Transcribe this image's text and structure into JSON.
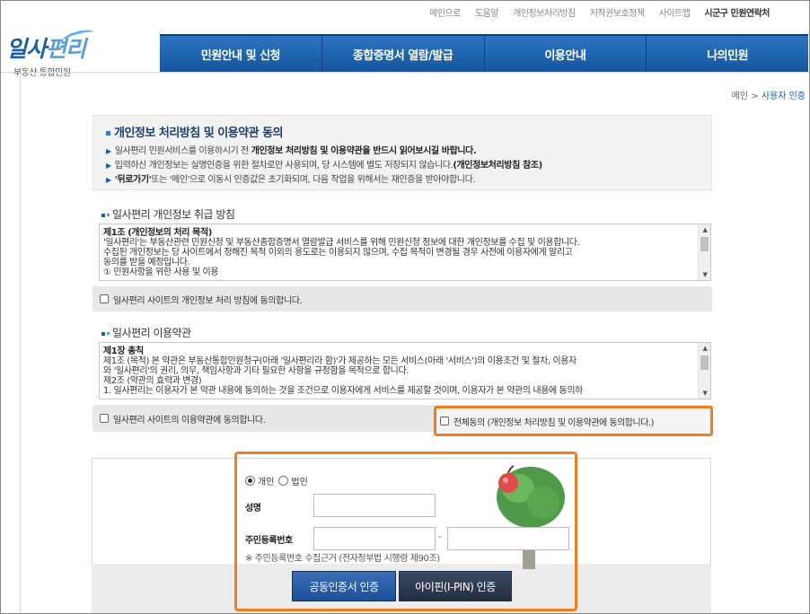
{
  "utility_links": [
    "메인으로",
    "도움말",
    "개인정보처리방침",
    "저작권보호정책",
    "사이트맵",
    "시군구 민원연락처"
  ],
  "logo": {
    "mark_main": "일사",
    "mark_accent": "편리",
    "subtitle": "부동산 통합민원"
  },
  "nav": [
    "민원안내 및 신청",
    "종합증명서 열람/발급",
    "이용안내",
    "나의민원"
  ],
  "breadcrumb": {
    "home": "메인",
    "separator": ">",
    "current": "사용자 인증"
  },
  "notice": {
    "title": "개인정보 처리방침 및 이용약관 동의",
    "items": [
      {
        "pre": "일사편리 민원서비스를 이용하시기 전 ",
        "bold": "개인정보 처리방침 및 이용약관을 반드시 읽어보시길 바랍니다.",
        "post": ""
      },
      {
        "pre": "입력하신 개인정보는 실명인증을 위한 절차로만 사용되며, 당 시스템에 별도 저장되지 않습니다.",
        "bold": "(개인정보처리방침 참조)",
        "post": ""
      },
      {
        "pre": "",
        "bold": "'뒤로가기'",
        "post": "또는 '메인'으로 이동시 인증값은 초기화되며, 다음 작업을 위해서는 재인증을 받아야합니다."
      }
    ]
  },
  "privacy": {
    "section_title": "일사편리 개인정보 취급 방침",
    "heading": "제1조 (개인정보의 처리 목적)",
    "lines": [
      "'일사편리'는 부동산관련 민원신청 및 부동산종합증명서 열람발급 서비스를 위해 민원신청 정보에 대한 개인정보를 수집 및 이용합니다.",
      "수집된 개인정보는 당 사이트에서 정해진 목적 이외의 용도로는 이용되지 않으며, 수집 목적이 변경될 경우 사전에 이용자에게 알리고",
      "동의를 받을 예정입니다.",
      "① 민원사항을 위한 사용 및 이용"
    ],
    "agree_label": "일사편리 사이트의 개인정보 처리 방침에 동의합니다."
  },
  "terms": {
    "section_title": "일사편리 이용약관",
    "heading": "제1장 총칙",
    "lines": [
      "제1조 (목적) 본 약관은 부동산통합민원청구(아래 '일사편리라 함)'가 제공하는 모든 서비스(아래 '서비스')의 이용조건 및 절차, 이용자",
      "와 '일사편리'의 권리, 의무, 책임사항과 기타 필요한 사항을 규정함을 목적으로 합니다.",
      "제2조 (약관의 효력과 변경)",
      "1. 일사편리는 이용자가 본 약관 내용에 동의하는 것을 조건으로 이용자에게 서비스를 제공할 것이며, 이용자가 본 약관의 내용에 동의하"
    ],
    "agree_label": "일사편리 사이트의 이용약관에 동의합니다."
  },
  "all_agree_label": "전체동의 (개인정보 처리방침 및 이용약관에 동의합니다.)",
  "auth": {
    "radio_personal": "개인",
    "radio_corporate": "법인",
    "name_label": "성명",
    "rrn_label": "주민등록번호",
    "rrn_separator": "-",
    "basis_text": "※ 주민등록번호 수집근거 (전자정부법 시행령 제90조)",
    "btn_cert": "공동인증서 인증",
    "btn_ipin": "아이핀(I-PIN) 인증"
  },
  "colors": {
    "nav_blue": "#1a5ea8",
    "highlight_orange": "#f07d24"
  }
}
